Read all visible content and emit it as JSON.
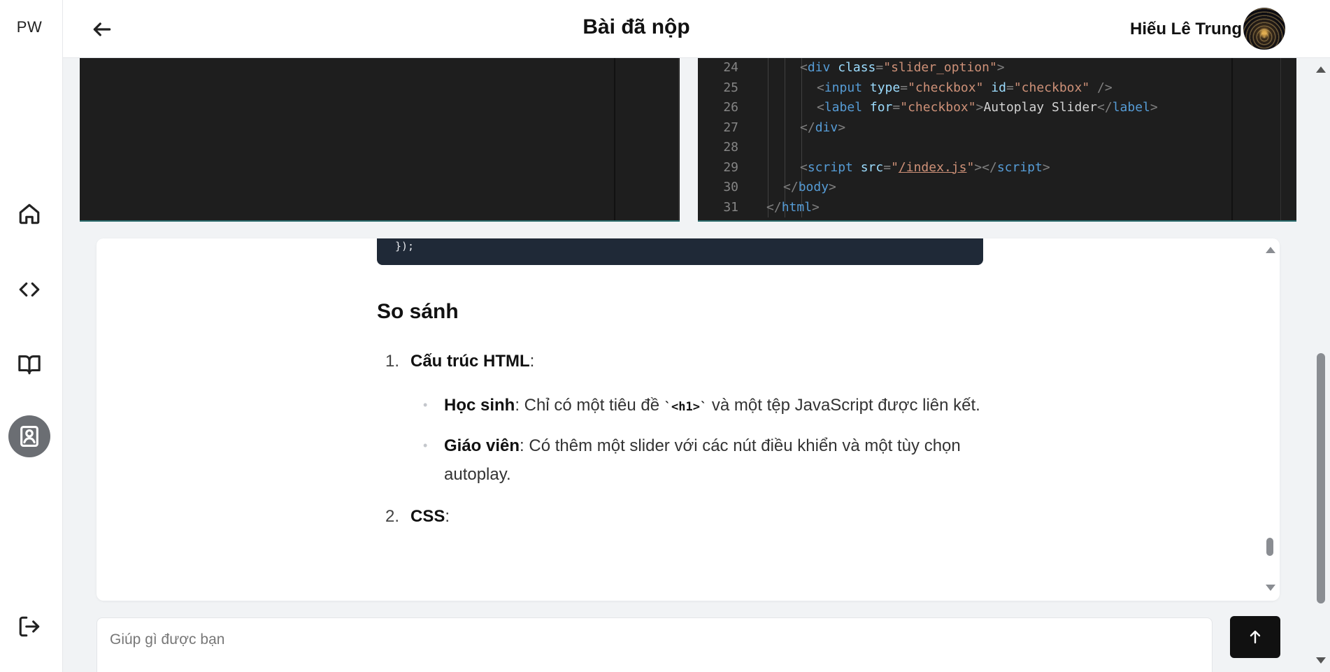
{
  "brand": "PW",
  "header": {
    "title": "Bài đã nộp",
    "user_name": "Hiếu Lê Trung"
  },
  "nav": [
    {
      "icon": "home-icon",
      "active": false
    },
    {
      "icon": "code-icon",
      "active": false
    },
    {
      "icon": "book-icon",
      "active": false
    },
    {
      "icon": "profile-icon",
      "active": true
    },
    {
      "icon": "logout-icon",
      "active": false
    }
  ],
  "editor_right": {
    "lines": [
      {
        "n": "24",
        "indent": 2,
        "tokens": [
          [
            "p",
            "<"
          ],
          [
            "tag",
            "div"
          ],
          [
            "d",
            " "
          ],
          [
            "attr",
            "class"
          ],
          [
            "p",
            "="
          ],
          [
            "str",
            "\"slider_option\""
          ],
          [
            "p",
            ">"
          ]
        ]
      },
      {
        "n": "25",
        "indent": 3,
        "tokens": [
          [
            "p",
            "<"
          ],
          [
            "tag",
            "input"
          ],
          [
            "d",
            " "
          ],
          [
            "attr",
            "type"
          ],
          [
            "p",
            "="
          ],
          [
            "str",
            "\"checkbox\""
          ],
          [
            "d",
            " "
          ],
          [
            "attr",
            "id"
          ],
          [
            "p",
            "="
          ],
          [
            "str",
            "\"checkbox\""
          ],
          [
            "d",
            " "
          ],
          [
            "p",
            "/>"
          ]
        ]
      },
      {
        "n": "26",
        "indent": 3,
        "tokens": [
          [
            "p",
            "<"
          ],
          [
            "tag",
            "label"
          ],
          [
            "d",
            " "
          ],
          [
            "attr",
            "for"
          ],
          [
            "p",
            "="
          ],
          [
            "str",
            "\"checkbox\""
          ],
          [
            "p",
            ">"
          ],
          [
            "d",
            "Autoplay Slider"
          ],
          [
            "p",
            "</"
          ],
          [
            "tag",
            "label"
          ],
          [
            "p",
            ">"
          ]
        ]
      },
      {
        "n": "27",
        "indent": 2,
        "tokens": [
          [
            "p",
            "</"
          ],
          [
            "tag",
            "div"
          ],
          [
            "p",
            ">"
          ]
        ]
      },
      {
        "n": "28",
        "indent": 0,
        "tokens": []
      },
      {
        "n": "29",
        "indent": 2,
        "tokens": [
          [
            "p",
            "<"
          ],
          [
            "tag",
            "script"
          ],
          [
            "d",
            " "
          ],
          [
            "attr",
            "src"
          ],
          [
            "p",
            "="
          ],
          [
            "str",
            "\""
          ],
          [
            "link",
            "/index.js"
          ],
          [
            "str",
            "\""
          ],
          [
            "p",
            "></"
          ],
          [
            "tag",
            "script"
          ],
          [
            "p",
            ">"
          ]
        ]
      },
      {
        "n": "30",
        "indent": 1,
        "tokens": [
          [
            "p",
            "</"
          ],
          [
            "tag",
            "body"
          ],
          [
            "p",
            ">"
          ]
        ]
      },
      {
        "n": "31",
        "indent": 0,
        "tokens": [
          [
            "p",
            "</"
          ],
          [
            "tag",
            "html"
          ],
          [
            "p",
            ">"
          ]
        ]
      }
    ]
  },
  "chat": {
    "code_tail": "});",
    "heading": "So sánh",
    "items": [
      {
        "num": "1.",
        "title": "Cấu trúc HTML",
        "suffix": ":",
        "bullets": [
          {
            "label": "Học sinh",
            "text_before": ": Chỉ có một tiêu đề ",
            "code": "`<h1>`",
            "text_after": " và một tệp JavaScript được liên kết."
          },
          {
            "label": "Giáo viên",
            "text_before": ": Có thêm một slider với các nút điều khiển và một tùy chọn autoplay.",
            "code": "",
            "text_after": ""
          }
        ]
      },
      {
        "num": "2.",
        "title": "CSS",
        "suffix": ":"
      }
    ]
  },
  "composer": {
    "placeholder": "Giúp gì được bạn"
  }
}
